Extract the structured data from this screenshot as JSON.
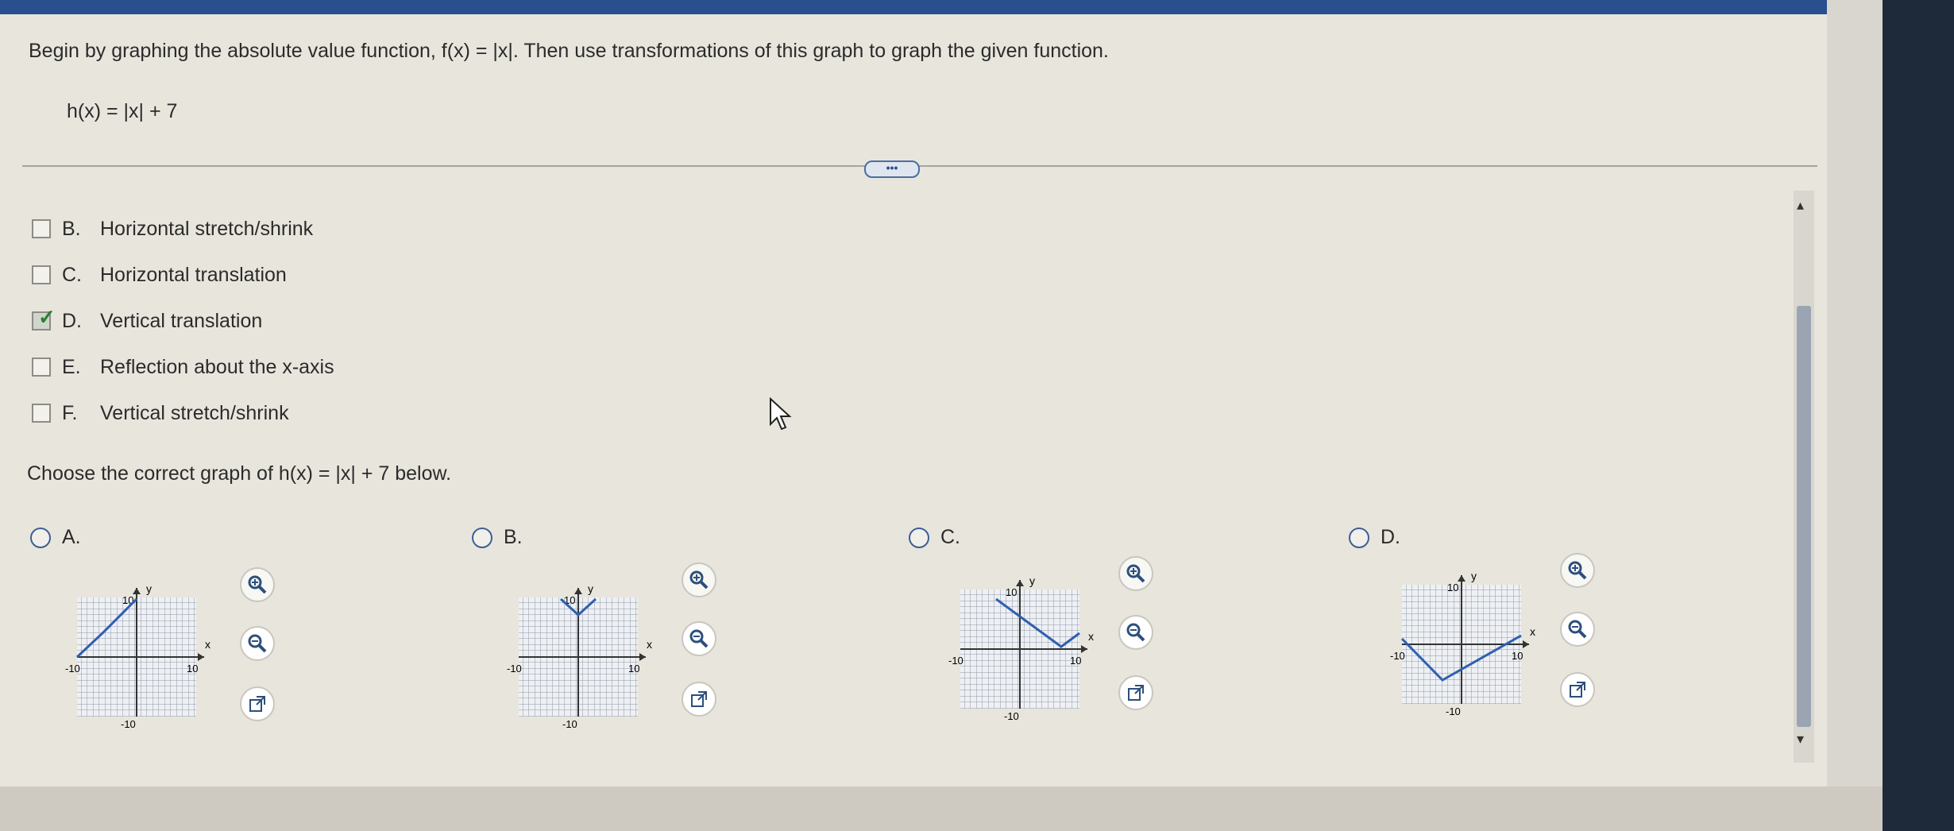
{
  "question": {
    "intro": "Begin by graphing the absolute value function, f(x) = |x|. Then use transformations of this graph to graph the given function.",
    "function": "h(x) = |x| + 7"
  },
  "more_button": "•••",
  "transformations": [
    {
      "letter": "B.",
      "label": "Horizontal stretch/shrink",
      "checked": false
    },
    {
      "letter": "C.",
      "label": "Horizontal translation",
      "checked": false
    },
    {
      "letter": "D.",
      "label": "Vertical translation",
      "checked": true
    },
    {
      "letter": "E.",
      "label": "Reflection about the x-axis",
      "checked": false
    },
    {
      "letter": "F.",
      "label": "Vertical stretch/shrink",
      "checked": false
    }
  ],
  "graph_prompt": "Choose the correct graph of h(x) = |x| + 7 below.",
  "graph_options": [
    {
      "letter": "A.",
      "axis_x": "x",
      "axis_y": "y",
      "tick_pos": "10",
      "tick_neg": "-10"
    },
    {
      "letter": "B.",
      "axis_x": "x",
      "axis_y": "y",
      "tick_pos": "10",
      "tick_neg": "-10"
    },
    {
      "letter": "C.",
      "axis_x": "x",
      "axis_y": "y",
      "tick_pos": "10",
      "tick_neg": "-10"
    },
    {
      "letter": "D.",
      "axis_x": "x",
      "axis_y": "y",
      "tick_pos": "10",
      "tick_neg": "-10"
    }
  ],
  "colors": {
    "curve": "#2f5fb0",
    "accent": "#2a4f8f",
    "check": "#2e7d32"
  },
  "icons": {
    "zoom_in": "zoom-in-icon",
    "zoom_out": "zoom-out-icon",
    "popout": "external-link-icon"
  }
}
